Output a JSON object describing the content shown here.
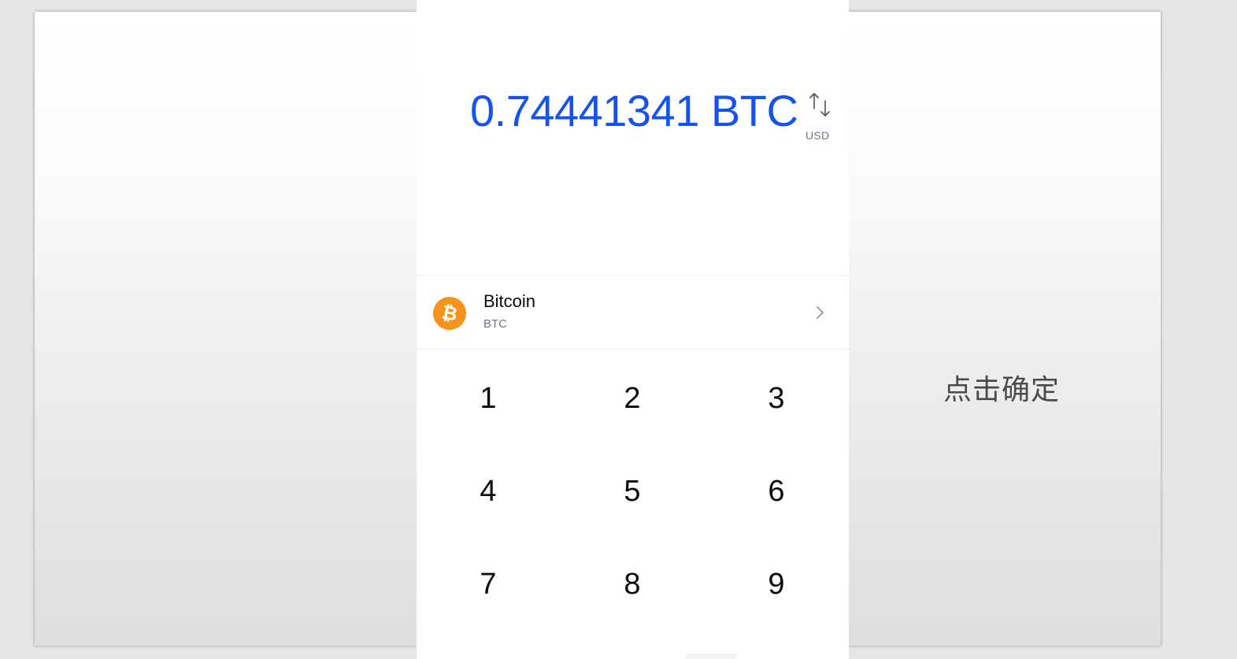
{
  "amount": {
    "value": "0.74441341 BTC",
    "toggle_currency": "USD",
    "toggle_icon": "swap-vertical-arrows-icon"
  },
  "asset": {
    "name": "Bitcoin",
    "ticker": "BTC",
    "icon": "bitcoin-icon",
    "icon_color": "#f7931a",
    "chevron_icon": "chevron-right-icon"
  },
  "keypad": {
    "keys": [
      "1",
      "2",
      "3",
      "4",
      "5",
      "6",
      "7",
      "8",
      "9"
    ]
  },
  "caption": "点击确定",
  "colors": {
    "accent": "#1652f0",
    "text_primary": "#0a0b0d",
    "text_secondary": "#6b7785"
  }
}
